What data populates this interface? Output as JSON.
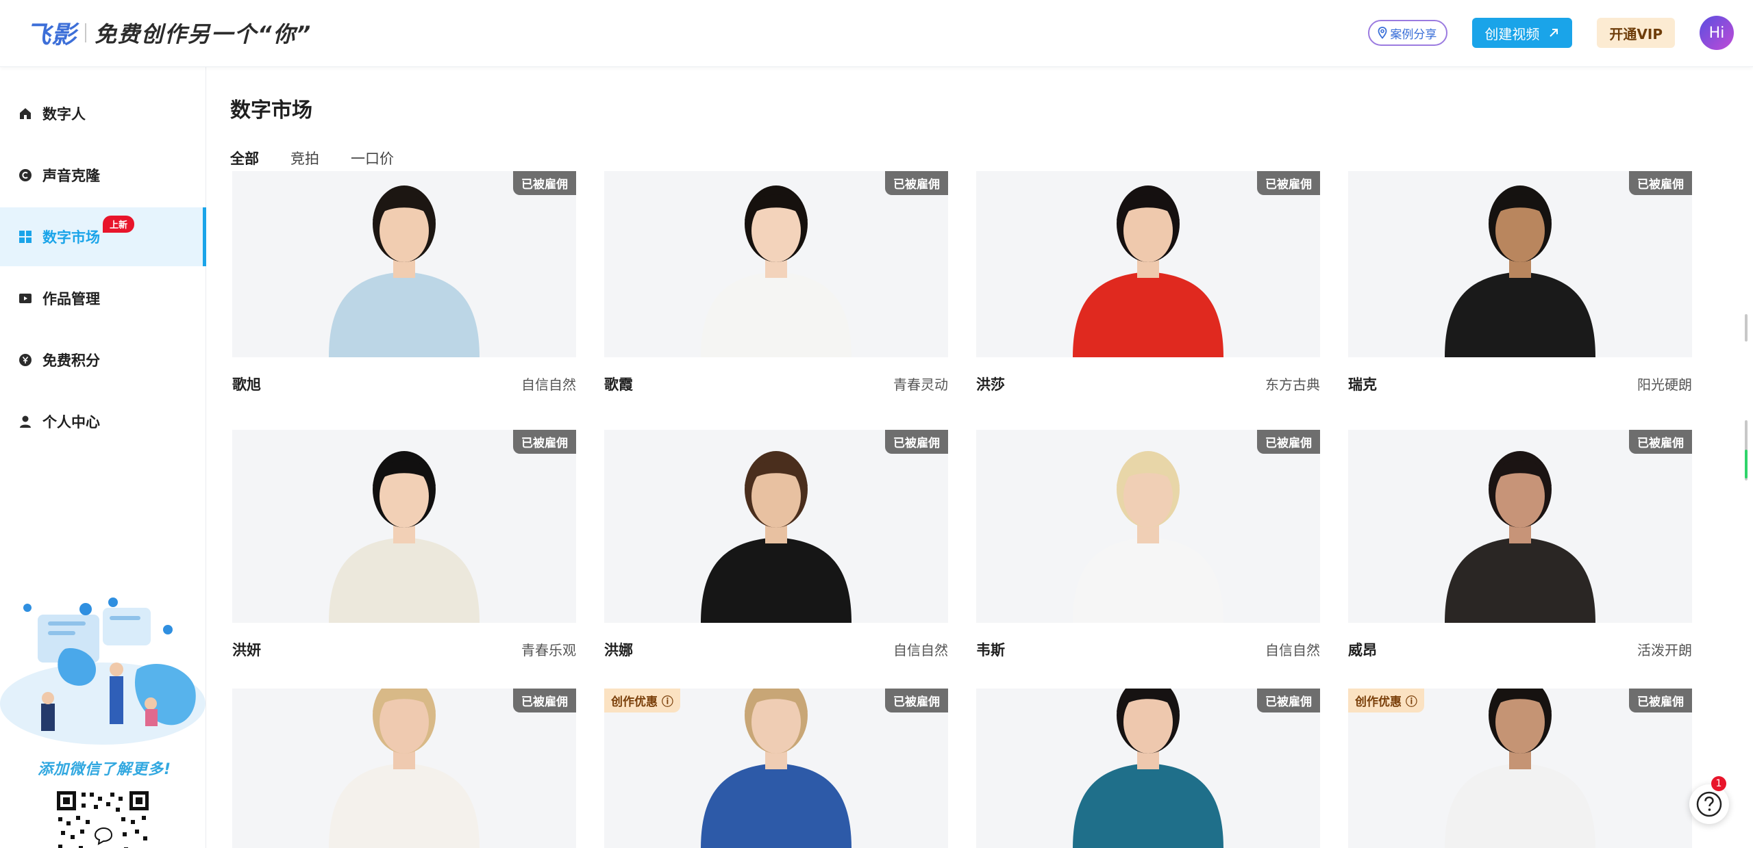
{
  "brand": {
    "logo": "飞影",
    "slogan": "免费创作另一个“你”"
  },
  "header": {
    "case_label": "案例分享",
    "create_label": "创建视频",
    "vip_label": "开通VIP",
    "avatar_text": "Hi"
  },
  "sidebar": {
    "items": [
      {
        "label": "数字人",
        "icon": "home-icon"
      },
      {
        "label": "声音克隆",
        "icon": "c-circle-icon"
      },
      {
        "label": "数字市场",
        "icon": "grid-icon",
        "badge": "上新"
      },
      {
        "label": "作品管理",
        "icon": "play-icon"
      },
      {
        "label": "免费积分",
        "icon": "yen-circle-icon"
      },
      {
        "label": "个人中心",
        "icon": "user-icon"
      }
    ],
    "promo_text": "添加微信了解更多!"
  },
  "main": {
    "title": "数字市场",
    "tabs": [
      "全部",
      "竞拍",
      "一口价"
    ],
    "hired_label": "已被雇佣",
    "promo_label": "创作优惠",
    "cards": [
      {
        "name": "歌旭",
        "style": "自信自然",
        "skin": "#f1cdb1",
        "hair": "#1c1612",
        "cloth": "#bcd6e6",
        "promo": false
      },
      {
        "name": "歌霞",
        "style": "青春灵动",
        "skin": "#f3d3bb",
        "hair": "#16110e",
        "cloth": "#f5f5f3",
        "promo": false
      },
      {
        "name": "洪莎",
        "style": "东方古典",
        "skin": "#efc9ad",
        "hair": "#151010",
        "cloth": "#e0291f",
        "promo": false
      },
      {
        "name": "瑞克",
        "style": "阳光硬朗",
        "skin": "#b9865e",
        "hair": "#151210",
        "cloth": "#1a1a1a",
        "promo": false
      },
      {
        "name": "洪妍",
        "style": "青春乐观",
        "skin": "#f2d0b6",
        "hair": "#111010",
        "cloth": "#ece8dc",
        "promo": false
      },
      {
        "name": "洪娜",
        "style": "自信自然",
        "skin": "#e8c1a1",
        "hair": "#4a2e1d",
        "cloth": "#161616",
        "promo": false
      },
      {
        "name": "韦斯",
        "style": "自信自然",
        "skin": "#f0cfb5",
        "hair": "#e8d6a8",
        "cloth": "#f6f6f6",
        "promo": false
      },
      {
        "name": "威昂",
        "style": "活泼开朗",
        "skin": "#c79478",
        "hair": "#1b1413",
        "cloth": "#2a2624",
        "promo": false
      },
      {
        "name": "",
        "style": "",
        "skin": "#efcab0",
        "hair": "#d8b987",
        "cloth": "#f4f1ec",
        "promo": false
      },
      {
        "name": "",
        "style": "",
        "skin": "#efcdb4",
        "hair": "#c8a676",
        "cloth": "#2d5aa8",
        "promo": true
      },
      {
        "name": "",
        "style": "",
        "skin": "#eec8ae",
        "hair": "#161212",
        "cloth": "#1f6f8a",
        "promo": false
      },
      {
        "name": "",
        "style": "",
        "skin": "#c59474",
        "hair": "#161210",
        "cloth": "#f2f2f2",
        "promo": true
      }
    ]
  },
  "help": {
    "badge_count": "1"
  },
  "colors": {
    "accent": "#1aa4e9",
    "hired_bg": "#6e6e6e",
    "promo_bg": "#fbe2c2",
    "vip_bg": "#fcebd2",
    "badge_red": "#e8152b"
  }
}
